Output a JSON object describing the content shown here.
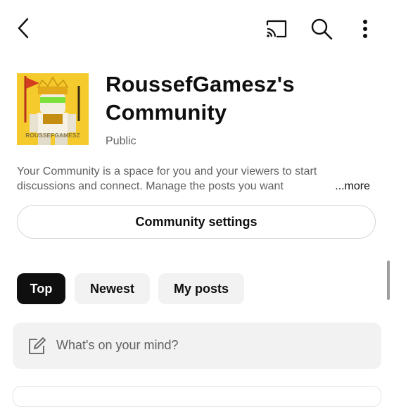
{
  "header": {
    "icons": [
      "back-arrow-icon",
      "cast-icon",
      "search-icon",
      "more-vert-icon"
    ]
  },
  "community": {
    "avatar_text": "ROUSSEFGAMESZ",
    "title": "RoussefGamesz's Community",
    "visibility": "Public",
    "description": "Your Community is a space for you and your viewers to start discussions and connect. Manage the posts you want",
    "more_label": "...more"
  },
  "settings_button": "Community settings",
  "filters": [
    {
      "label": "Top",
      "selected": true
    },
    {
      "label": "Newest",
      "selected": false
    },
    {
      "label": "My posts",
      "selected": false
    }
  ],
  "composer": {
    "placeholder": "What's on your mind?",
    "icon": "edit-icon"
  },
  "colors": {
    "text_primary": "#0f0f0f",
    "text_secondary": "#606060",
    "chip_selected_bg": "#0f0f0f",
    "chip_bg": "#f2f2f2",
    "avatar_bg": "#f2c21b"
  }
}
